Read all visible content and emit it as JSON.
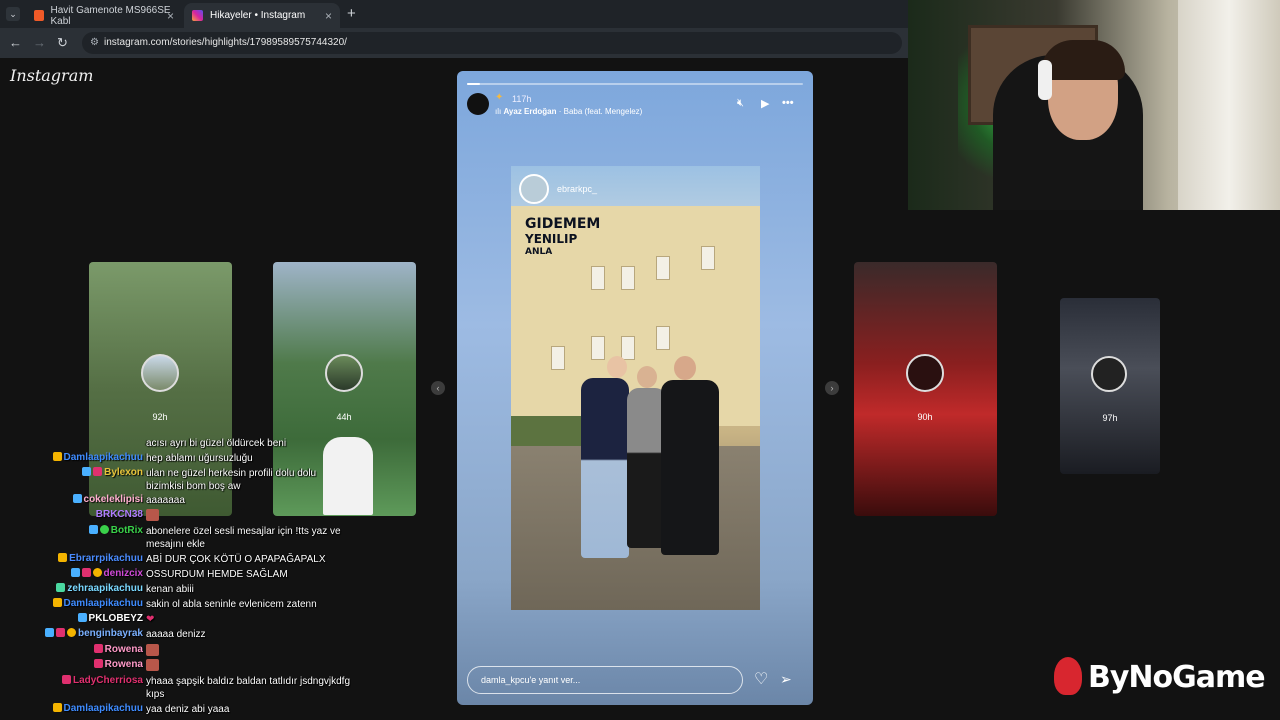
{
  "browser": {
    "tabs": [
      {
        "title": "Havit Gamenote MS966SE Kabl",
        "favicon_color": "#f05a28",
        "active": false
      },
      {
        "title": "Hikayeler • Instagram",
        "favicon_color": "#d6249f",
        "active": true
      }
    ],
    "url": "instagram.com/stories/highlights/17989589575744320/",
    "new_tab": "+",
    "close_glyph": "×"
  },
  "instagram": {
    "logo": "Instagram",
    "previews_left": [
      {
        "time": "92h"
      },
      {
        "time": "44h"
      }
    ],
    "previews_right": [
      {
        "time": "90h"
      },
      {
        "time": "97h"
      }
    ],
    "story": {
      "time": "117h",
      "music_artist": "Ayaz Erdoğan",
      "music_title": "· Baba (feat. Mengelez)",
      "progress": 0.04,
      "photo_username": "ebrarkpc_",
      "photo_text_line1": "GIDEMEM",
      "photo_text_line2": "YENILIP",
      "photo_text_line3": "ANLA",
      "reply_placeholder": "damla_kpcu'e yanıt ver..."
    }
  },
  "chat": [
    {
      "user": "",
      "color": "#ffffff",
      "text": "acısı ayrı bi güzel öldürcek beni"
    },
    {
      "user": "Damlaapikachuu",
      "color": "#3f8cff",
      "text": "hep ablamı uğursuzluğu"
    },
    {
      "user": "Bylexon",
      "color": "#e6c23a",
      "text": "ulan ne güzel herkesin profili dolu dolu"
    },
    {
      "user": "",
      "color": "#ffffff",
      "text": "bizimkisi bom boş aw"
    },
    {
      "user": "cokeleklipisi",
      "color": "#ffb0d0",
      "text": "aaaaaaa"
    },
    {
      "user": "BRKCN38",
      "color": "#b07cff",
      "text": ""
    },
    {
      "user": "BotRix",
      "color": "#3ad14a",
      "text": "abonelere özel sesli mesajlar için !tts yaz ve"
    },
    {
      "user": "",
      "color": "#ffffff",
      "text": "mesajını ekle"
    },
    {
      "user": "Ebrarrpikachuu",
      "color": "#4a8cff",
      "text": "ABİ DUR ÇOK KÖTÜ O APAPAĞAPALX"
    },
    {
      "user": "denizcix",
      "color": "#d04ad8",
      "text": "OSSURDUM HEMDE SAĞLAM"
    },
    {
      "user": "zehraapikachuu",
      "color": "#7ad8ff",
      "text": "kenan abiii"
    },
    {
      "user": "Damlaapikachuu",
      "color": "#3f8cff",
      "text": "sakin ol abla seninle evlenicem zatenn"
    },
    {
      "user": "PKLOBEYZ",
      "color": "#ffffff",
      "text": ""
    },
    {
      "user": "benginbayrak",
      "color": "#7ab0ff",
      "text": "aaaaa denizz"
    },
    {
      "user": "Rowena",
      "color": "#ff9ac8",
      "text": ""
    },
    {
      "user": "Rowena",
      "color": "#ff9ac8",
      "text": ""
    },
    {
      "user": "LadyCherriosa",
      "color": "#e0306f",
      "text": "yhaaa şapşik baldız baldan tatlıdır jsdngvjkdfg"
    },
    {
      "user": "",
      "color": "#ffffff",
      "text": "kıps"
    },
    {
      "user": "Damlaapikachuu",
      "color": "#3f8cff",
      "text": "yaa deniz abi yaaa"
    }
  ],
  "overlay": {
    "brand": "ByNoGame"
  }
}
